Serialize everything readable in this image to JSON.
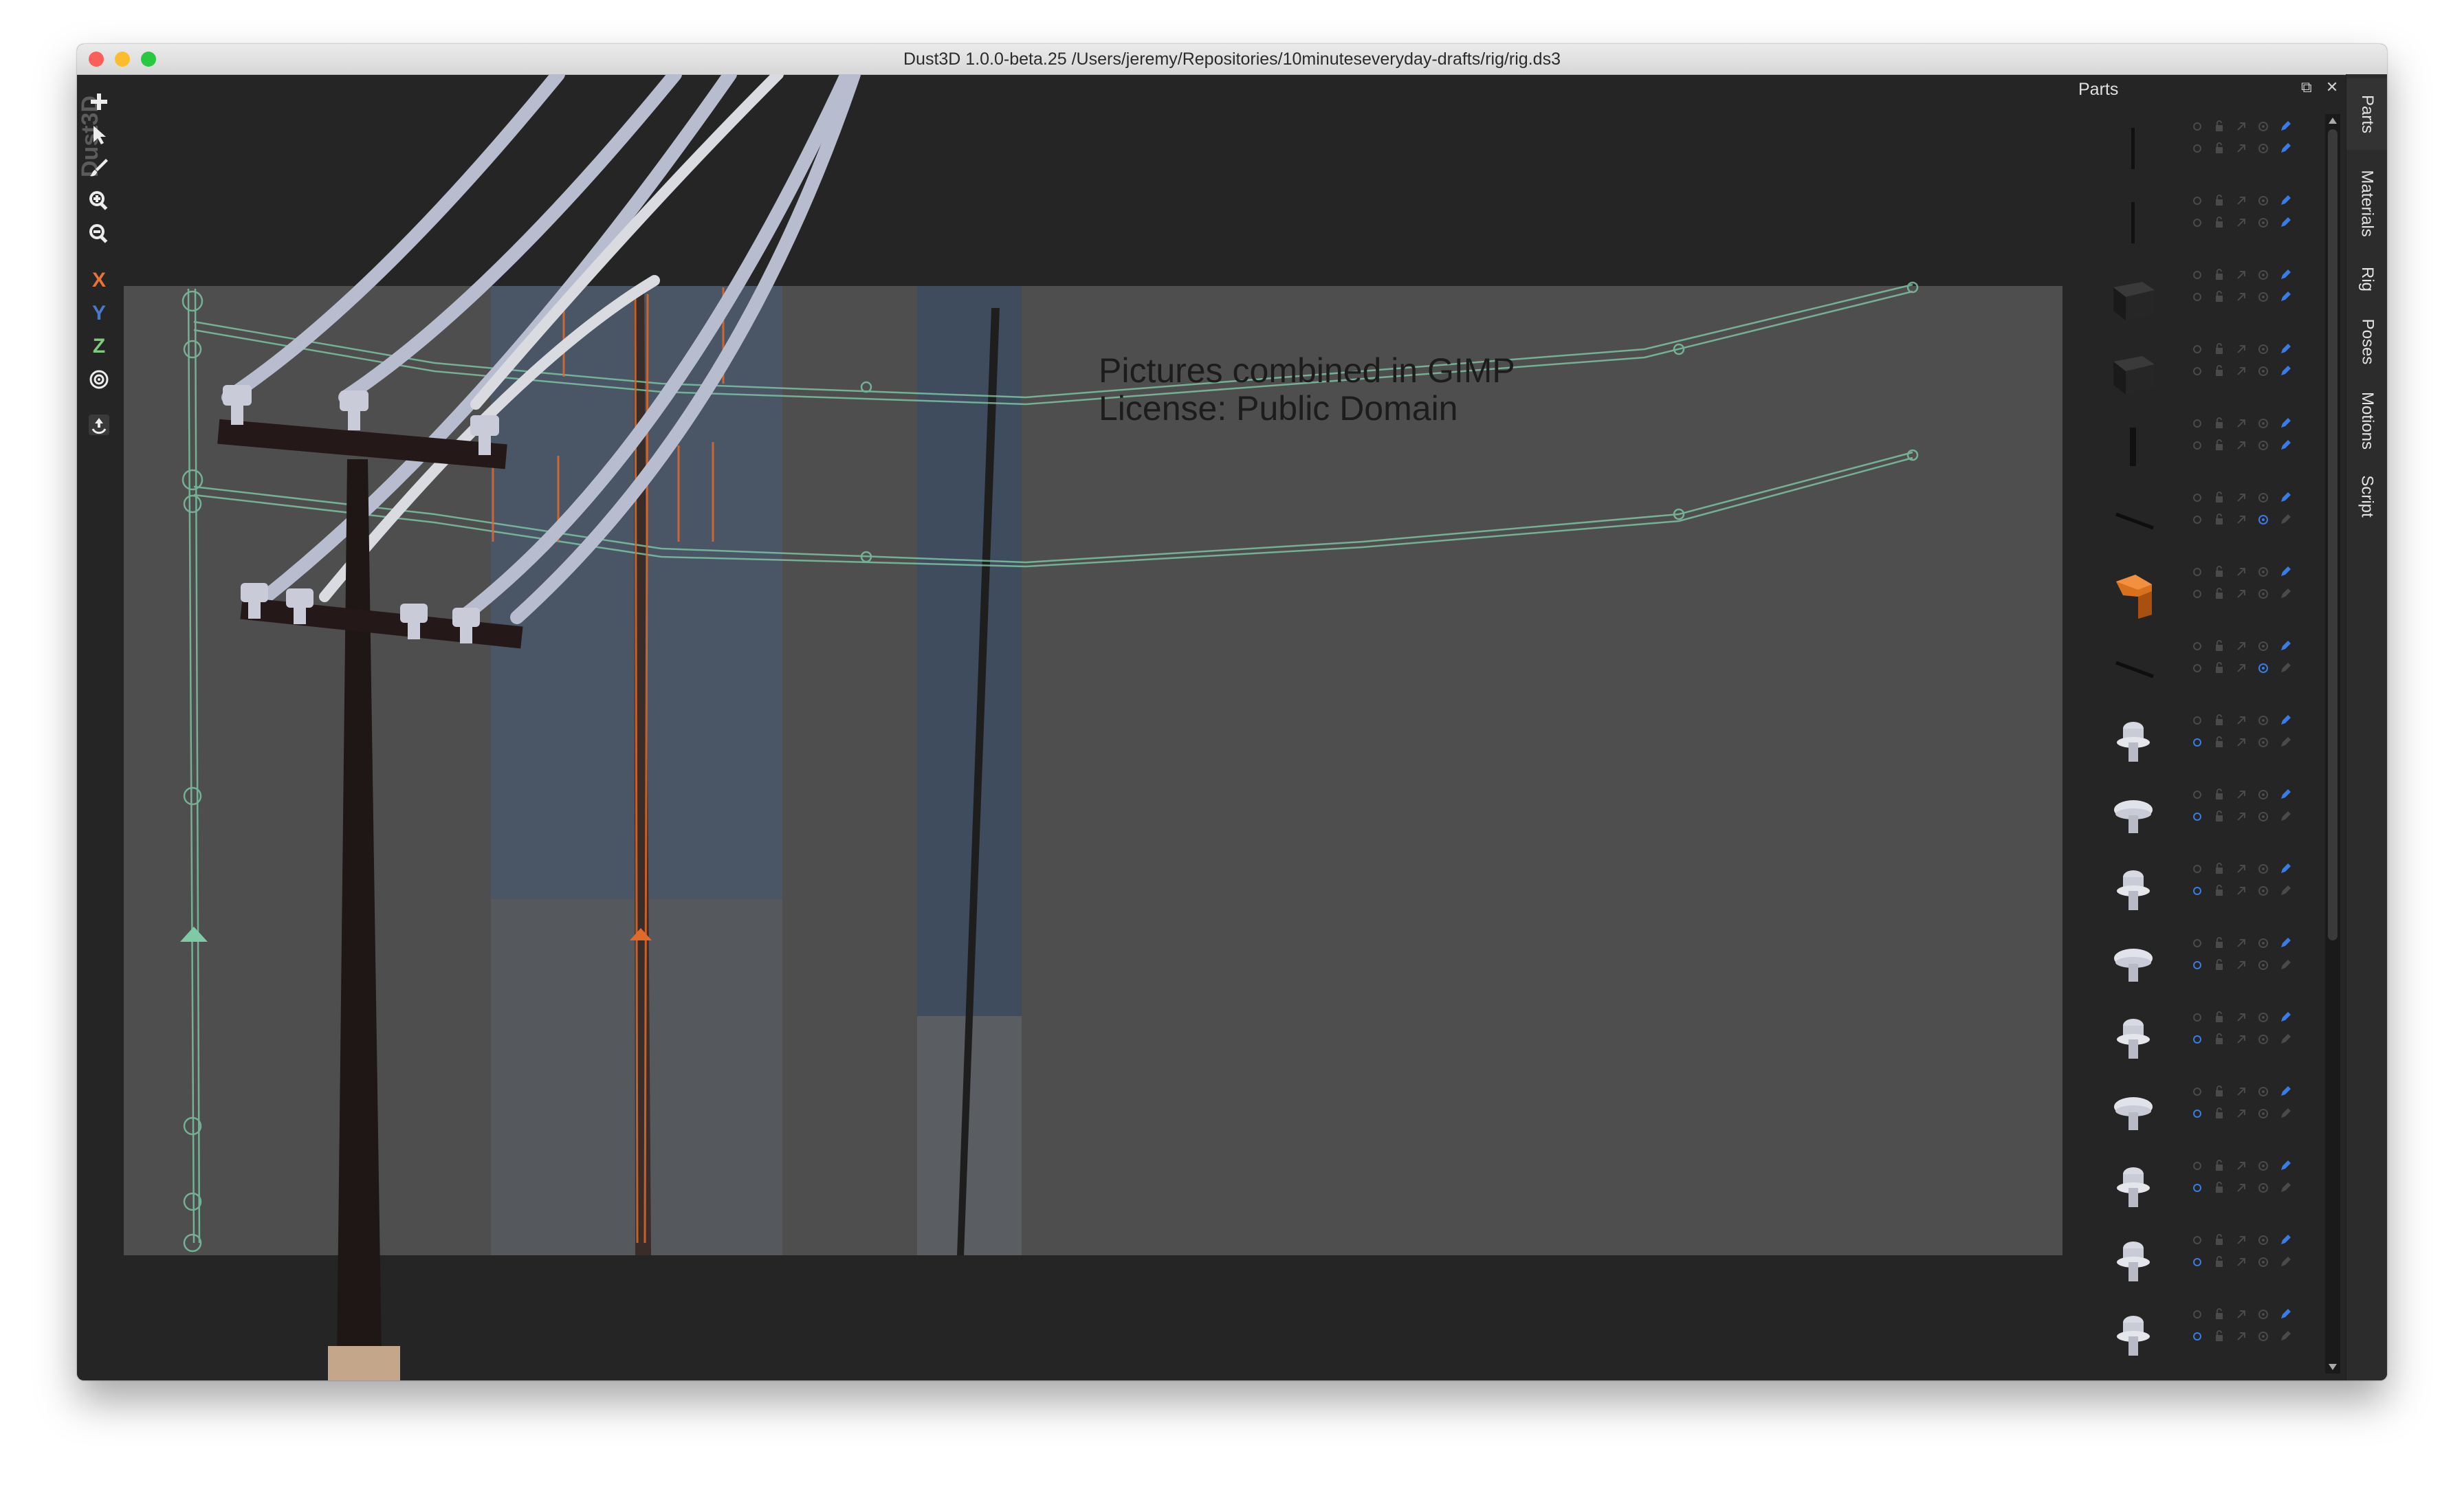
{
  "window": {
    "title": "Dust3D 1.0.0-beta.25 /Users/jeremy/Repositories/10minuteseveryday-drafts/rig/rig.ds3",
    "traffic_lights": [
      "#fc5f57",
      "#fdbc2e",
      "#28c840"
    ]
  },
  "toolbar": {
    "tools": [
      {
        "name": "add-icon",
        "label": ""
      },
      {
        "name": "select-icon",
        "label": ""
      },
      {
        "name": "paint-brush-icon",
        "label": ""
      },
      {
        "name": "zoom-in-icon",
        "label": ""
      },
      {
        "name": "zoom-out-icon",
        "label": ""
      },
      {
        "name": "x-axis-lock",
        "label": "X",
        "color": "#e8713c"
      },
      {
        "name": "y-axis-lock",
        "label": "Y",
        "color": "#4a78c8"
      },
      {
        "name": "z-axis-lock",
        "label": "Z",
        "color": "#7fca7f"
      },
      {
        "name": "radius-lock-icon",
        "label": ""
      },
      {
        "name": "regenerate-icon",
        "label": ""
      }
    ]
  },
  "viewport": {
    "overlay_line1": "Pictures combined in GIMP",
    "overlay_line2": "License: Public Domain",
    "watermark": "Dust3D"
  },
  "parts_panel": {
    "title": "Parts",
    "dock_float": "⧉",
    "dock_close": "✕",
    "parts": [
      {
        "thumb": "thin-post"
      },
      {
        "thumb": "thin-post"
      },
      {
        "thumb": "dark-cube"
      },
      {
        "thumb": "dark-cube"
      },
      {
        "thumb": "short-post"
      },
      {
        "thumb": "diagonal-rod"
      },
      {
        "thumb": "orange-bracket"
      },
      {
        "thumb": "diagonal-rod"
      },
      {
        "thumb": "insulator"
      },
      {
        "thumb": "insulator-flat"
      },
      {
        "thumb": "insulator"
      },
      {
        "thumb": "insulator-flat"
      },
      {
        "thumb": "insulator"
      },
      {
        "thumb": "insulator-flat"
      },
      {
        "thumb": "insulator"
      },
      {
        "thumb": "insulator"
      },
      {
        "thumb": "insulator"
      }
    ]
  },
  "side_tabs": [
    "Parts",
    "Materials",
    "Rig",
    "Poses",
    "Motions",
    "Script"
  ],
  "colors": {
    "accent_blue": "#3b7be8",
    "rig_green": "#7fc9a6",
    "rig_orange": "#e06a2a"
  }
}
